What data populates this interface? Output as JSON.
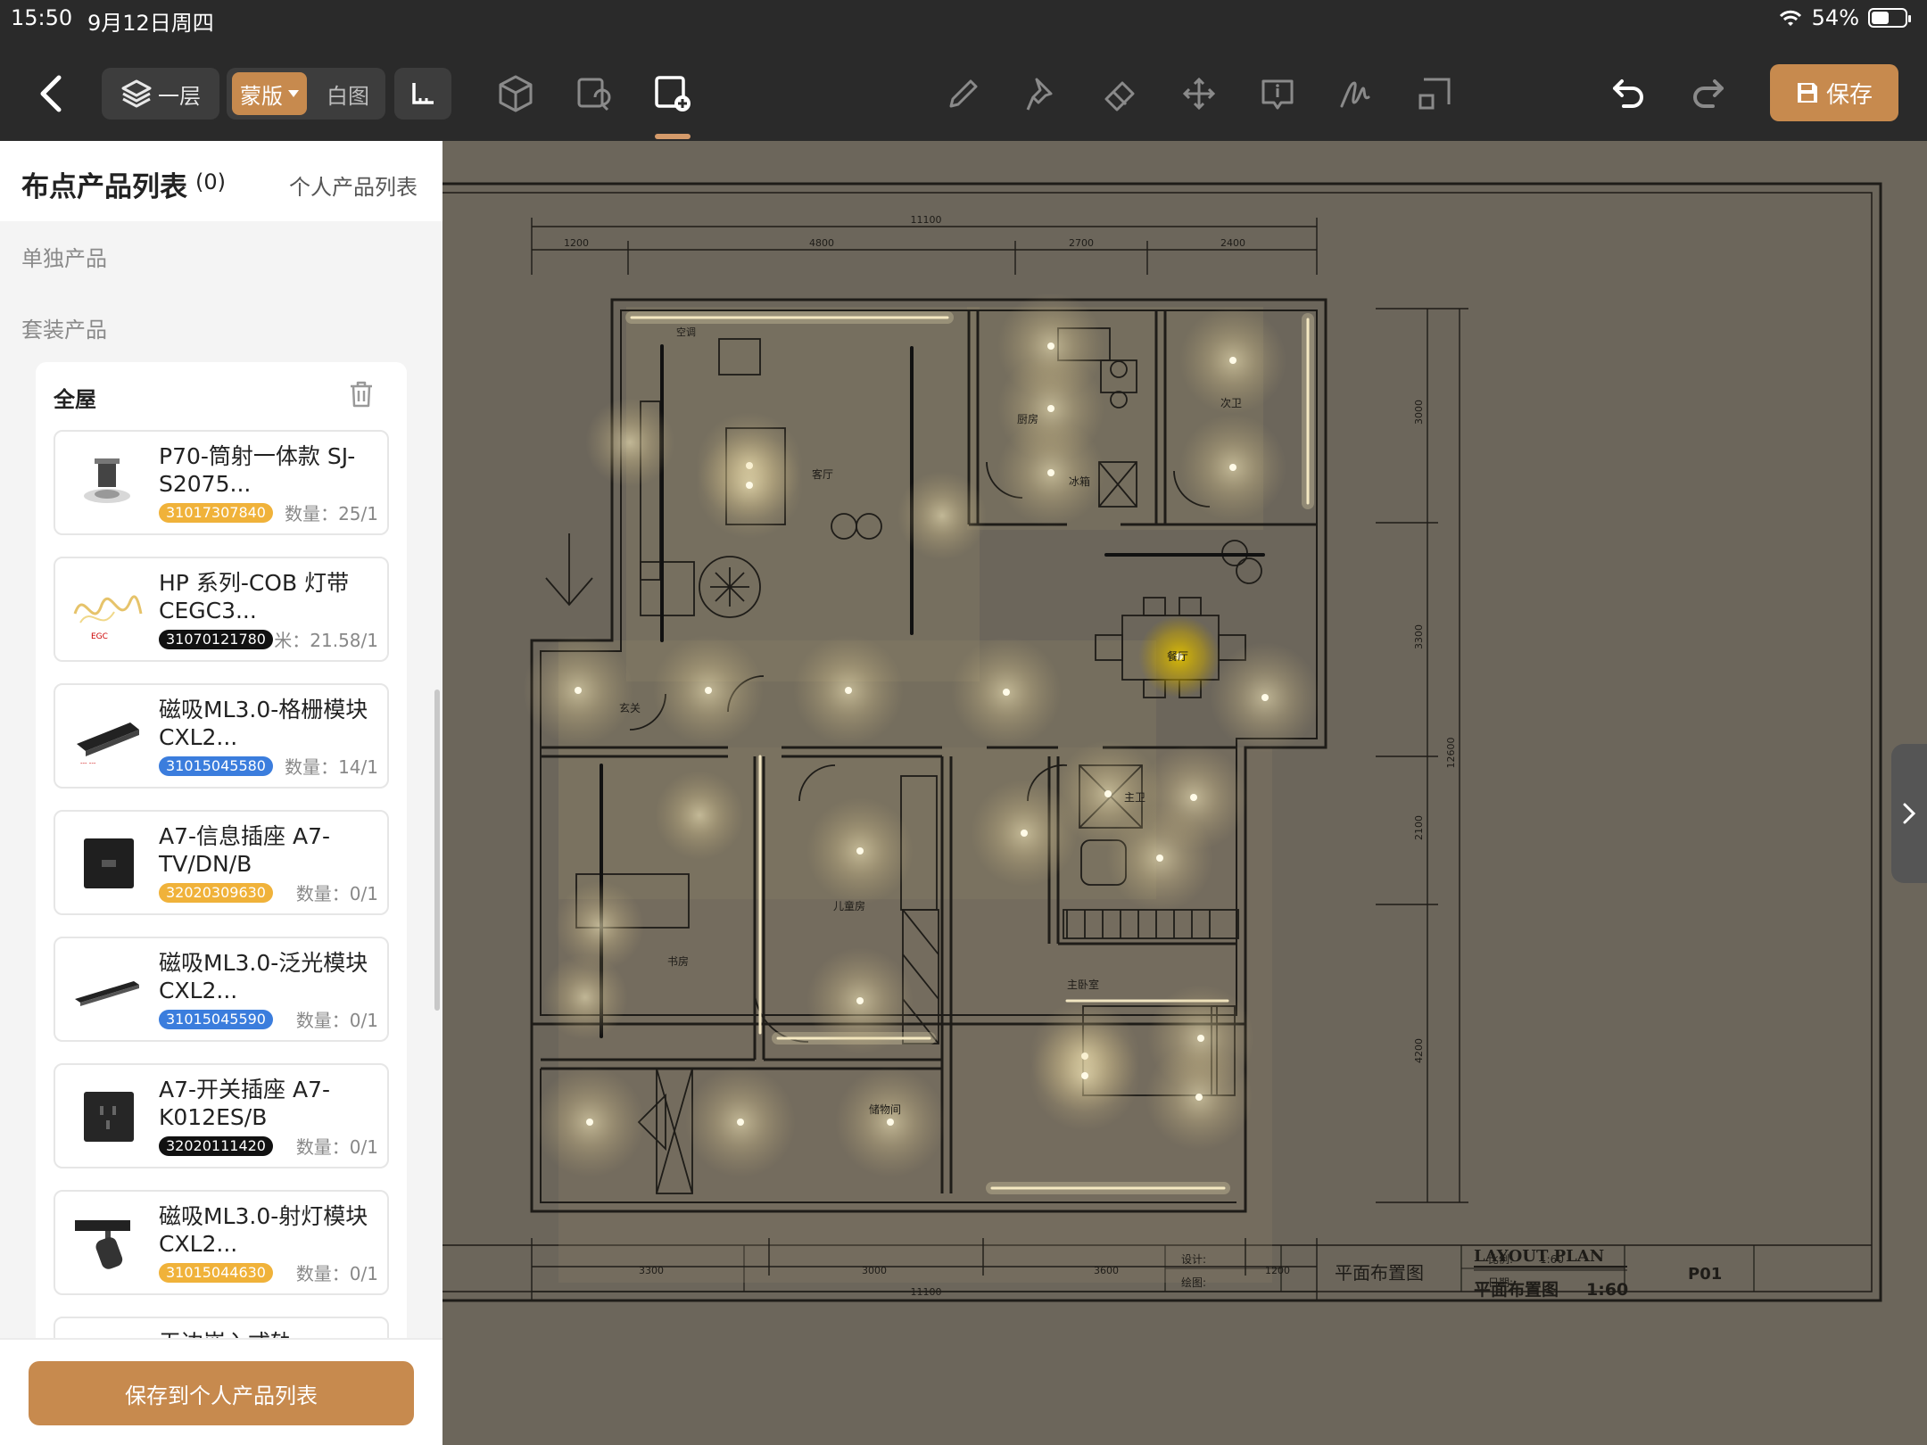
{
  "status": {
    "time": "15:50",
    "date": "9月12日周四",
    "battery": "54%",
    "battery_level": 0.54
  },
  "toolbar": {
    "layer_label": "一层",
    "mengban_label": "蒙版",
    "baitu_label": "白图",
    "save_label": "保存",
    "icons": [
      "back-icon",
      "layers-icon",
      "ruler-icon",
      "cube-icon",
      "copy-area-icon",
      "add-device-icon",
      "pencil-icon",
      "pin-icon",
      "eraser-icon",
      "move-icon",
      "info-icon",
      "signature-icon",
      "crop-icon",
      "undo-icon",
      "redo-icon",
      "save-disk-icon"
    ]
  },
  "panel": {
    "title": "布点产品列表",
    "count": "(0)",
    "personal_link": "个人产品列表",
    "section_single": "单独产品",
    "section_set": "套装产品",
    "group_title": "全屋",
    "save_personal": "保存到个人产品列表",
    "products": [
      {
        "name": "P70-筒射一体款 SJ-S2075...",
        "code": "31017307840",
        "code_color": "#f0b23a",
        "qty": "数量：25/1",
        "img": "downlight"
      },
      {
        "name": "HP 系列-COB 灯带 CEGC3...",
        "code": "31070121780",
        "code_color": "#111111",
        "qty": "米：21.58/1",
        "img": "strip"
      },
      {
        "name": "磁吸ML3.0-格栅模块 CXL2...",
        "code": "31015045580",
        "code_color": "#3b7ddd",
        "qty": "数量：14/1",
        "img": "grille"
      },
      {
        "name": "A7-信息插座 A7-TV/DN/B",
        "code": "32020309630",
        "code_color": "#f0b23a",
        "qty": "数量：0/1",
        "img": "socket-info"
      },
      {
        "name": "磁吸ML3.0-泛光模块 CXL2...",
        "code": "31015045590",
        "code_color": "#3b7ddd",
        "qty": "数量：0/1",
        "img": "flood"
      },
      {
        "name": "A7-开关插座 A7-K012ES/B",
        "code": "32020111420",
        "code_color": "#111111",
        "qty": "数量：0/1",
        "img": "socket-switch"
      },
      {
        "name": "磁吸ML3.0-射灯模块 CXL2...",
        "code": "31015044630",
        "code_color": "#f0b23a",
        "qty": "数量：0/1",
        "img": "spot"
      },
      {
        "name": "无边嵌入式轨",
        "code": "",
        "code_color": "#f0b23a",
        "qty": "",
        "img": "track"
      }
    ]
  },
  "plan": {
    "dims_top": [
      "1200",
      "4800",
      "2700",
      "2400"
    ],
    "dim_total": "11100",
    "dims_bottom": [
      "3300",
      "3000",
      "3600",
      "1200"
    ],
    "dims_right": [
      "3000",
      "3300",
      "12600",
      "2100",
      "4200"
    ],
    "rooms": [
      "客厅",
      "厨房",
      "次卫",
      "冰箱",
      "书房",
      "儿童房",
      "主卫",
      "主卧室",
      "储物间",
      "玄关",
      "餐厅",
      "空调"
    ],
    "caption_en": "LAYOUT PLAN",
    "caption_cn": "平面布置图",
    "scale": "1:60",
    "titleblock": {
      "design": "设计:",
      "draw": "绘图:",
      "name": "平面布置图",
      "ratio": "比例:",
      "ratio_val": "1:60",
      "date": "日期:",
      "sheet": "P01"
    }
  }
}
